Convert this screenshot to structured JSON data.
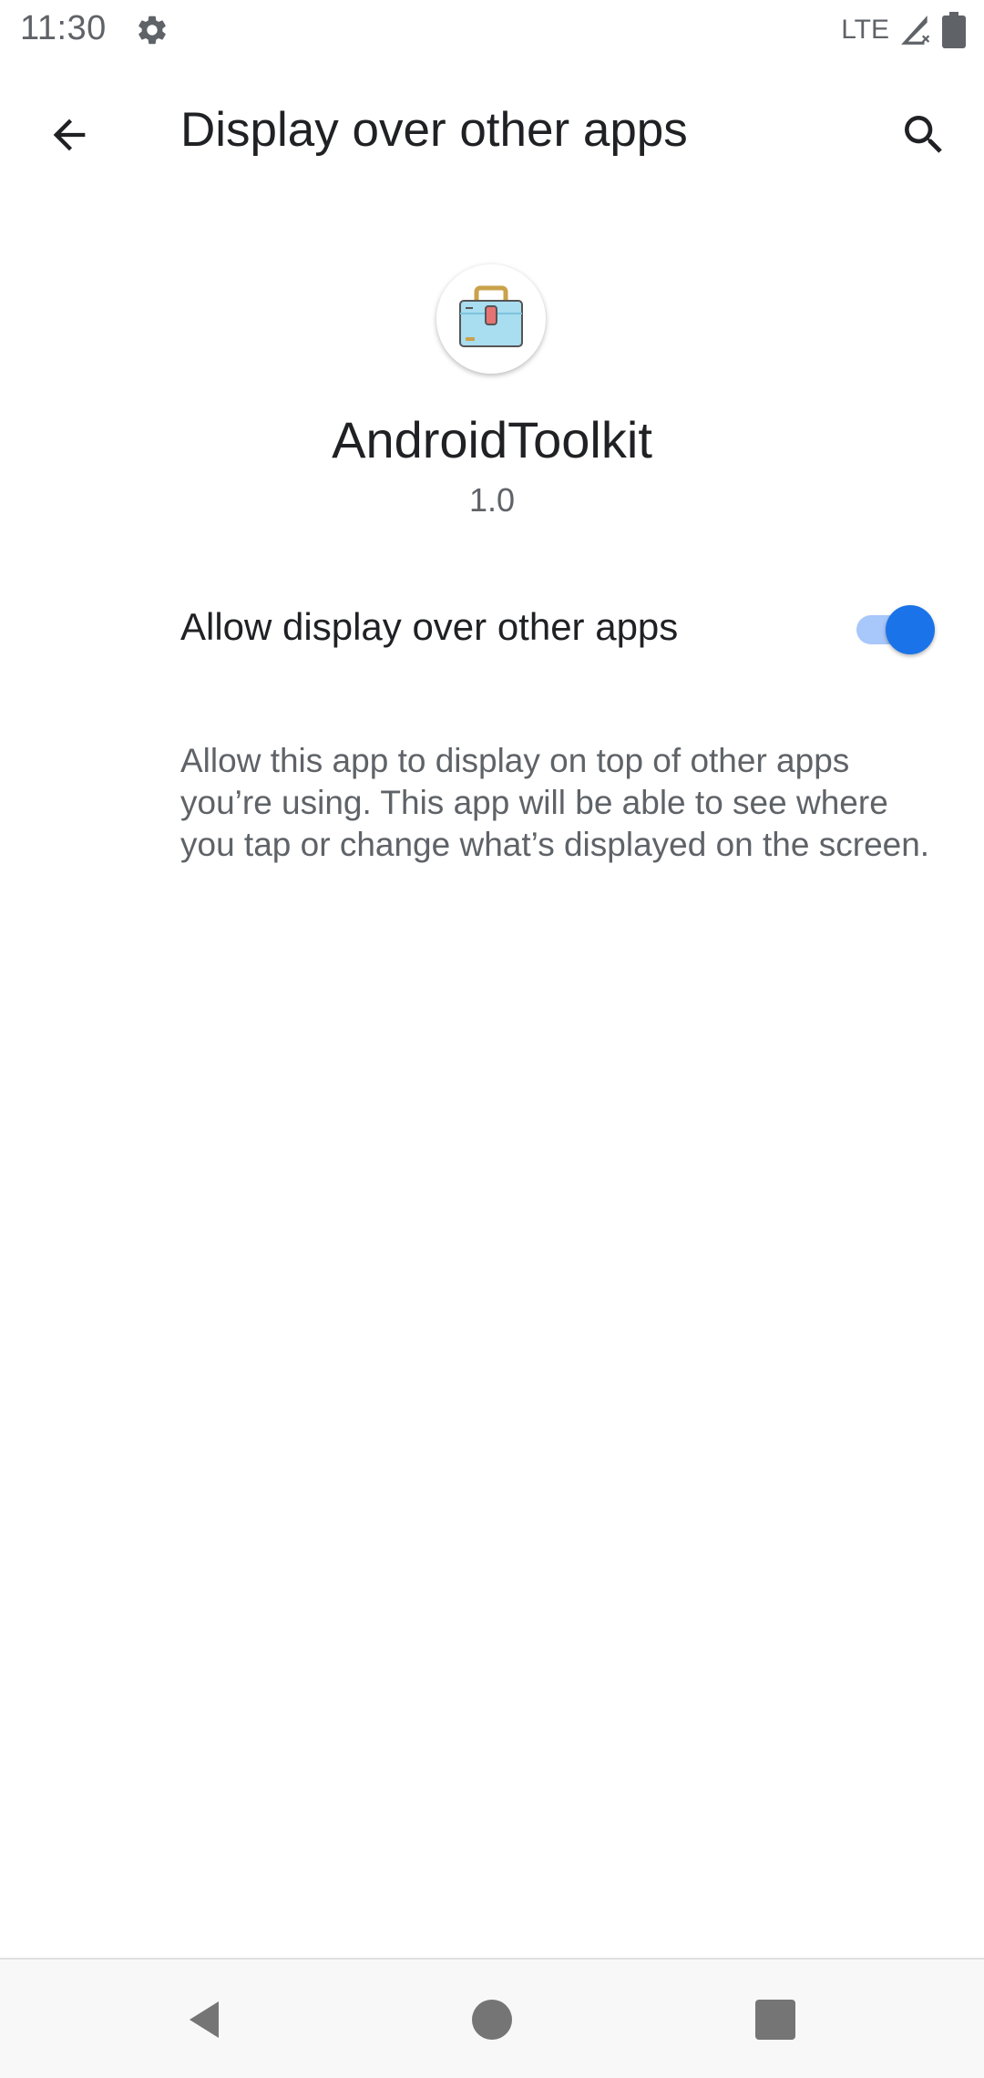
{
  "status_bar": {
    "time": "11:30",
    "network": "LTE",
    "icons": [
      "settings-icon",
      "signal-icon",
      "battery-icon"
    ]
  },
  "toolbar": {
    "title": "Display over other apps",
    "back_icon": "arrow-back-icon",
    "search_icon": "search-icon"
  },
  "app": {
    "name": "AndroidToolkit",
    "version": "1.0",
    "icon": "toolbox-icon"
  },
  "setting": {
    "label": "Allow display over other apps",
    "enabled": true,
    "description": "Allow this app to display on top of other apps you’re using. This app will be able to see where you tap or change what’s displayed on the screen."
  },
  "navigation": {
    "back_icon": "nav-back-icon",
    "home_icon": "nav-home-icon",
    "recents_icon": "nav-recents-icon"
  },
  "colors": {
    "accent": "#1a73e8",
    "accent_track": "#a8c7fa",
    "secondary_text": "#5f6368"
  }
}
